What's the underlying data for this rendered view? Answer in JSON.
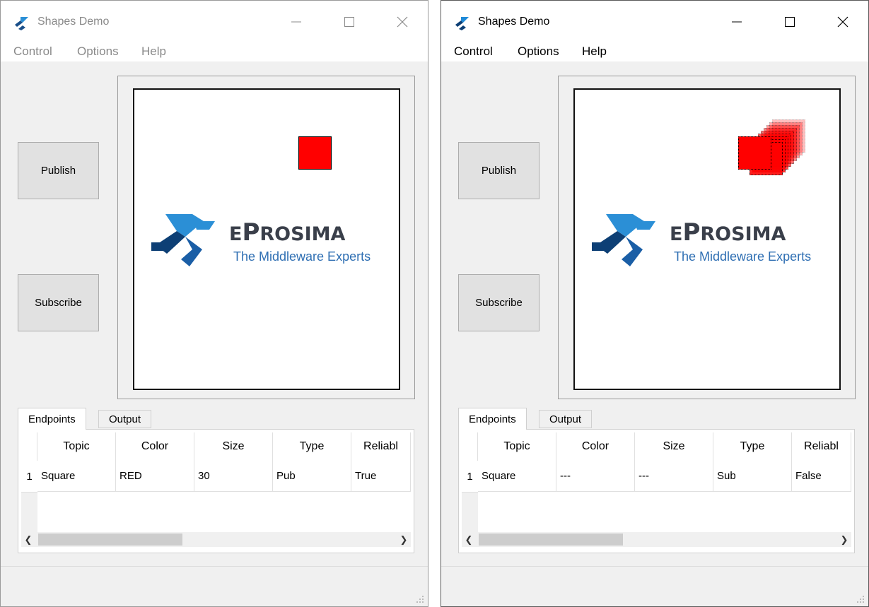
{
  "windows": [
    {
      "state": "inactive",
      "title": "Shapes Demo",
      "menu": [
        "Control",
        "Options",
        "Help"
      ],
      "buttons": {
        "publish": "Publish",
        "subscribe": "Subscribe"
      },
      "logo": {
        "word_first": "E",
        "word_big": "P",
        "word_rest": "ROSIMA",
        "tagline": "The Middleware Experts"
      },
      "tabs": [
        "Endpoints",
        "Output"
      ],
      "table": {
        "headers": [
          "Topic",
          "Color",
          "Size",
          "Type",
          "Reliabl"
        ],
        "rows": [
          {
            "num": "1",
            "cells": [
              "Square",
              "RED",
              "30",
              "Pub",
              "True"
            ]
          }
        ]
      },
      "shape": {
        "kind": "square",
        "color": "#ff0000"
      }
    },
    {
      "state": "active",
      "title": "Shapes Demo",
      "menu": [
        "Control",
        "Options",
        "Help"
      ],
      "buttons": {
        "publish": "Publish",
        "subscribe": "Subscribe"
      },
      "logo": {
        "word_first": "E",
        "word_big": "P",
        "word_rest": "ROSIMA",
        "tagline": "The Middleware Experts"
      },
      "tabs": [
        "Endpoints",
        "Output"
      ],
      "table": {
        "headers": [
          "Topic",
          "Color",
          "Size",
          "Type",
          "Reliabl"
        ],
        "rows": [
          {
            "num": "1",
            "cells": [
              "Square",
              "---",
              "---",
              "Sub",
              "False"
            ]
          }
        ]
      },
      "shape": {
        "kind": "square-history",
        "color": "#ff0000"
      }
    }
  ],
  "icons": {
    "app": "eprosima-logo-icon",
    "minimize": "minimize-icon",
    "maximize": "maximize-icon",
    "close": "close-icon",
    "scroll_left": "chevron-left-icon",
    "scroll_right": "chevron-right-icon",
    "grip": "resize-grip-icon"
  }
}
